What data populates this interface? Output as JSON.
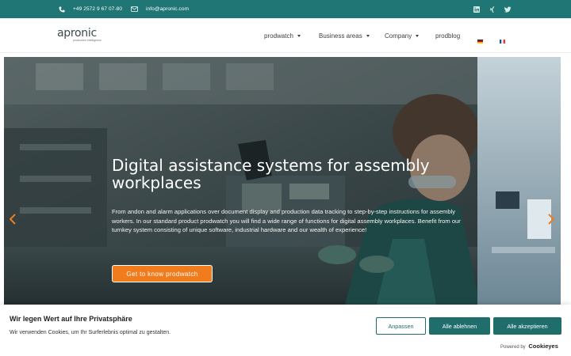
{
  "topbar": {
    "phone": "+49 2572 9 67 07-80",
    "email": "info@apronic.com",
    "social": [
      "linkedin-icon",
      "xing-icon",
      "twitter-icon"
    ]
  },
  "header": {
    "logo_text": "apronic",
    "logo_tagline": "production intelligence",
    "nav": [
      {
        "label": "prodwatch",
        "dropdown": true
      },
      {
        "label": "Business areas",
        "dropdown": true
      },
      {
        "label": "Company",
        "dropdown": true
      },
      {
        "label": "prodblog",
        "dropdown": false
      }
    ],
    "languages": [
      "flag-de-icon",
      "flag-fr-icon"
    ]
  },
  "hero": {
    "title": "Digital assistance systems for assembly workplaces",
    "text": "From andon and alarm applications over document display and production data tracking to step-by-step instructions for assembly workers. In our standard product prodwatch you will find a wide range of functions for digital assembly workplaces. Benefit from our turnkey system consisting of unique software, industrial hardware and our wealth of experience!",
    "button": "Get to know prodwatch"
  },
  "cookie": {
    "title": "Wir legen Wert auf Ihre Privatsphäre",
    "text": "Wir verwenden Cookies, um Ihr Surferlebnis optimal zu gestalten.",
    "customize": "Anpassen",
    "reject": "Alle ablehnen",
    "accept": "Alle akzeptieren",
    "powered_prefix": "Powered by",
    "powered_brand": "Cookieyes"
  },
  "colors": {
    "brand_teal": "#1f7674",
    "accent_orange": "#f07c1e"
  }
}
